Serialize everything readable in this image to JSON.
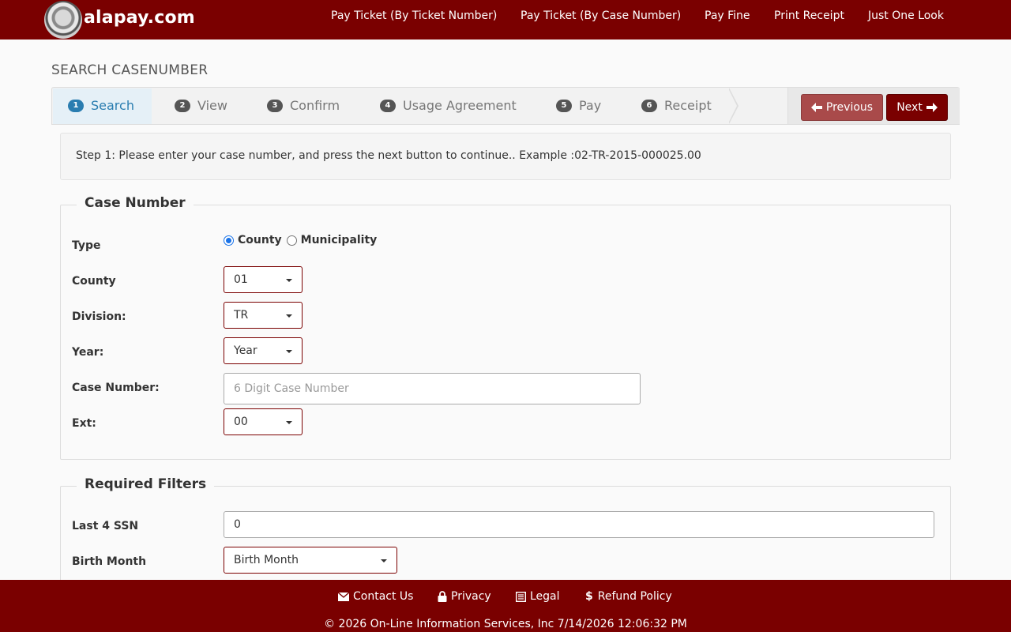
{
  "header": {
    "brand": "alapay.com",
    "nav": [
      "Pay Ticket (By Ticket Number)",
      "Pay Ticket (By Case Number)",
      "Pay Fine",
      "Print Receipt",
      "Just One Look"
    ]
  },
  "page_title": "SEARCH CASENUMBER",
  "wizard": {
    "steps": [
      {
        "num": "1",
        "label": "Search"
      },
      {
        "num": "2",
        "label": "View"
      },
      {
        "num": "3",
        "label": "Confirm"
      },
      {
        "num": "4",
        "label": "Usage Agreement"
      },
      {
        "num": "5",
        "label": "Pay"
      },
      {
        "num": "6",
        "label": "Receipt"
      }
    ],
    "active_step": 1,
    "previous_label": "Previous",
    "next_label": "Next"
  },
  "info_text": "Step 1: Please enter your case number, and press the next button to continue.. Example :02-TR-2015-000025.00",
  "case_number_section": {
    "legend": "Case Number",
    "type_label": "Type",
    "type_options": [
      "County",
      "Municipality"
    ],
    "type_selected": "County",
    "county_label": "County",
    "county_value": "01",
    "division_label": "Division:",
    "division_value": "TR",
    "year_label": "Year:",
    "year_value": "Year",
    "case_number_label": "Case Number:",
    "case_number_placeholder": "6 Digit Case Number",
    "ext_label": "Ext:",
    "ext_value": "00"
  },
  "required_filters": {
    "legend": "Required Filters",
    "ssn_label": "Last 4 SSN",
    "ssn_value": "0",
    "birth_month_label": "Birth Month",
    "birth_month_value": "Birth Month"
  },
  "footer": {
    "links": [
      "Contact Us",
      "Privacy",
      "Legal",
      "Refund Policy"
    ],
    "copyright": "© 2026 On-Line Information Services, Inc 7/14/2026 12:06:32 PM"
  },
  "colors": {
    "brand": "#7a0000",
    "active_step": "#2a7db0",
    "previous_button": "#a94a4a"
  }
}
